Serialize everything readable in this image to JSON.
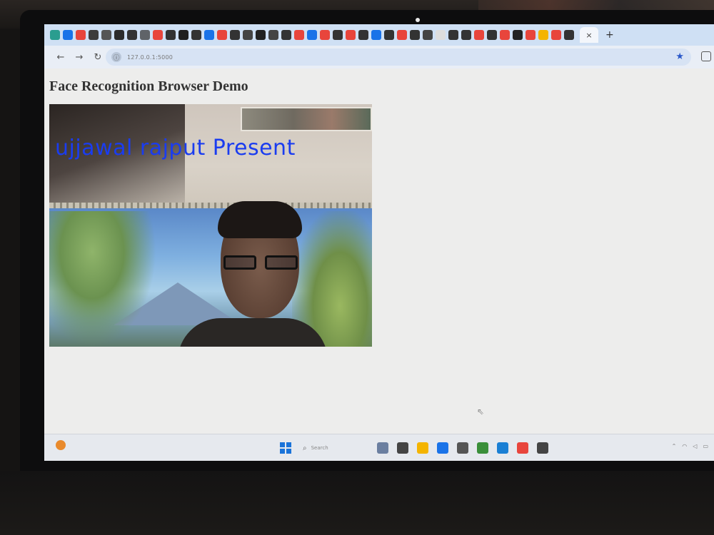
{
  "browser": {
    "url": "127.0.0.1:5000",
    "tab_close": "×",
    "new_tab": "+",
    "nav": {
      "back": "←",
      "forward": "→",
      "reload": "↻"
    },
    "bookmark_star": "★",
    "favicon_colors": [
      "#2a9d8f",
      "#1a73e8",
      "#e8453c",
      "#3c3c3c",
      "#555555",
      "#2b2b2b",
      "#333333",
      "#5f6368",
      "#e8453c",
      "#333333",
      "#1f1f1f",
      "#333333",
      "#1a73e8",
      "#e8453c",
      "#333333",
      "#444444",
      "#222222",
      "#444444",
      "#333333",
      "#e8453c",
      "#1a73e8",
      "#e8453c",
      "#333333",
      "#e8453c",
      "#333333",
      "#1a73e8",
      "#333333",
      "#e8453c",
      "#333333",
      "#444444",
      "#dddddd",
      "#333333",
      "#333333",
      "#e8453c",
      "#333333",
      "#e8453c",
      "#222222",
      "#e8453c",
      "#f4b400",
      "#e8453c",
      "#333333"
    ]
  },
  "page": {
    "title": "Face Recognition Browser Demo",
    "video_overlay": "ujjawal rajput Present"
  },
  "taskbar": {
    "search_placeholder": "Search",
    "app_colors": [
      "#6b7fa0",
      "#444444",
      "#f4b400",
      "#1a73e8",
      "#555555",
      "#3a8f3a",
      "#1a7fd4",
      "#e8453c",
      "#444444"
    ]
  }
}
